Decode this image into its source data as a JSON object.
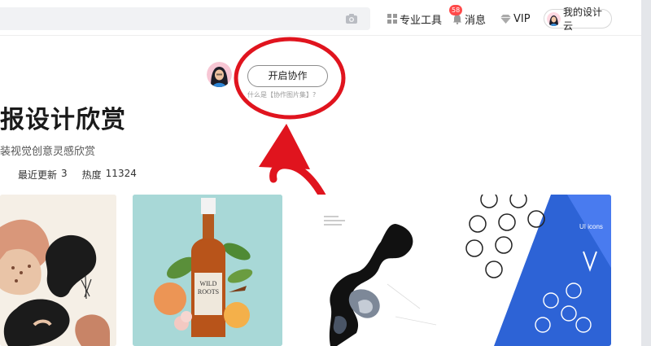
{
  "header": {
    "search": {
      "placeholder": ""
    },
    "icons": {
      "camera": "camera-icon",
      "tools": "grid-icon",
      "messages": "bell-icon",
      "vip": "diamond-icon"
    },
    "nav": {
      "tools_label": "专业工具",
      "messages_label": "消息",
      "messages_badge": "58",
      "vip_label": "VIP",
      "cloud_label": "我的设计云"
    }
  },
  "collab": {
    "button_label": "开启协作",
    "help_text": "什么是【协作图片集】?",
    "annotation_color": "#e0141e"
  },
  "collection": {
    "title": "报设计欣赏",
    "subtitle": "装视觉创意灵感欣赏",
    "stats": {
      "recent_label": "最近更新",
      "recent_value": "3",
      "heat_label": "热度",
      "heat_value": "11324"
    }
  },
  "gallery": {
    "cards": [
      {
        "name": "abstract-shapes-poster"
      },
      {
        "name": "wild-roots-bottle-poster",
        "label_text": "WILD\nROOTS"
      },
      {
        "name": "ink-splash-poster"
      },
      {
        "name": "ui-icons-poster",
        "label_text": "UI icons"
      }
    ]
  }
}
